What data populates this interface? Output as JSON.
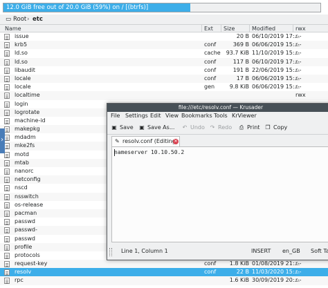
{
  "panel": {
    "free_space": {
      "text": "12.0 GiB free out of 20.0 GiB (59%) on / [(btrfs)]",
      "used_fraction": 0.59
    },
    "path": {
      "root": "Root",
      "separator": "›",
      "folder": "etc"
    },
    "columns": {
      "name": "Name",
      "ext": "Ext",
      "size": "Size",
      "modified": "Modified",
      "rwx": "rwx"
    },
    "files": [
      {
        "name": "issue",
        "ext": "",
        "size": "20 B",
        "modified": "06/10/2019 17:...",
        "rwx": "r--"
      },
      {
        "name": "krb5",
        "ext": "conf",
        "size": "369 B",
        "modified": "06/06/2019 15:...",
        "rwx": "r--"
      },
      {
        "name": "ld.so",
        "ext": "cache",
        "size": "93.7 KiB",
        "modified": "11/10/2019 15:...",
        "rwx": "r--"
      },
      {
        "name": "ld.so",
        "ext": "conf",
        "size": "117 B",
        "modified": "06/10/2019 17:...",
        "rwx": "r--"
      },
      {
        "name": "libaudit",
        "ext": "conf",
        "size": "191 B",
        "modified": "22/06/2019 15:...",
        "rwx": "r--"
      },
      {
        "name": "locale",
        "ext": "conf",
        "size": "17 B",
        "modified": "06/06/2019 15:...",
        "rwx": "r--"
      },
      {
        "name": "locale",
        "ext": "gen",
        "size": "9.8 KiB",
        "modified": "06/06/2019 15:...",
        "rwx": "r--"
      },
      {
        "name": "localtime",
        "ext": "",
        "size": "",
        "modified": "",
        "rwx": "rwx"
      },
      {
        "name": "login",
        "ext": "",
        "size": "",
        "modified": "",
        "rwx": ""
      },
      {
        "name": "logrotate",
        "ext": "",
        "size": "",
        "modified": "",
        "rwx": ""
      },
      {
        "name": "machine-id",
        "ext": "",
        "size": "",
        "modified": "",
        "rwx": ""
      },
      {
        "name": "makepkg",
        "ext": "",
        "size": "",
        "modified": "",
        "rwx": ""
      },
      {
        "name": "mdadm",
        "ext": "",
        "size": "",
        "modified": "",
        "rwx": ""
      },
      {
        "name": "mke2fs",
        "ext": "",
        "size": "",
        "modified": "",
        "rwx": ""
      },
      {
        "name": "motd",
        "ext": "",
        "size": "",
        "modified": "",
        "rwx": ""
      },
      {
        "name": "mtab",
        "ext": "",
        "size": "",
        "modified": "",
        "rwx": ""
      },
      {
        "name": "nanorc",
        "ext": "",
        "size": "",
        "modified": "",
        "rwx": ""
      },
      {
        "name": "netconfig",
        "ext": "",
        "size": "",
        "modified": "",
        "rwx": ""
      },
      {
        "name": "nscd",
        "ext": "",
        "size": "",
        "modified": "",
        "rwx": ""
      },
      {
        "name": "nsswitch",
        "ext": "",
        "size": "",
        "modified": "",
        "rwx": ""
      },
      {
        "name": "os-release",
        "ext": "",
        "size": "",
        "modified": "",
        "rwx": ""
      },
      {
        "name": "pacman",
        "ext": "",
        "size": "",
        "modified": "",
        "rwx": ""
      },
      {
        "name": "passwd",
        "ext": "",
        "size": "",
        "modified": "",
        "rwx": ""
      },
      {
        "name": "passwd-",
        "ext": "",
        "size": "",
        "modified": "",
        "rwx": ""
      },
      {
        "name": "passwd",
        "ext": "",
        "size": "",
        "modified": "",
        "rwx": ""
      },
      {
        "name": "profile",
        "ext": "",
        "size": "",
        "modified": "",
        "rwx": ""
      },
      {
        "name": "protocols",
        "ext": "",
        "size": "",
        "modified": "",
        "rwx": ""
      },
      {
        "name": "request-key",
        "ext": "conf",
        "size": "1.8 KiB",
        "modified": "01/08/2019 21:...",
        "rwx": "r--"
      },
      {
        "name": "resolv",
        "ext": "conf",
        "size": "22 B",
        "modified": "11/03/2020 15:...",
        "rwx": "r--",
        "selected": true
      },
      {
        "name": "rpc",
        "ext": "",
        "size": "1.6 KiB",
        "modified": "30/09/2019 20:...",
        "rwx": "r--"
      }
    ]
  },
  "editor": {
    "title": "file:///etc/resolv.conf — Krusader",
    "menu": [
      "File",
      "Settings",
      "Edit",
      "View",
      "Bookmarks",
      "Tools",
      "KrViewer"
    ],
    "toolbar": {
      "save": "Save",
      "save_as": "Save As...",
      "undo": "Undo",
      "redo": "Redo",
      "print": "Print",
      "copy": "Copy"
    },
    "tab_label": "resolv.conf (Editing)",
    "content": "nameserver 10.10.50.2",
    "status": {
      "position": "Line 1, Column 1",
      "mode": "INSERT",
      "locale": "en_GB",
      "tabs": "Soft Ta"
    }
  }
}
